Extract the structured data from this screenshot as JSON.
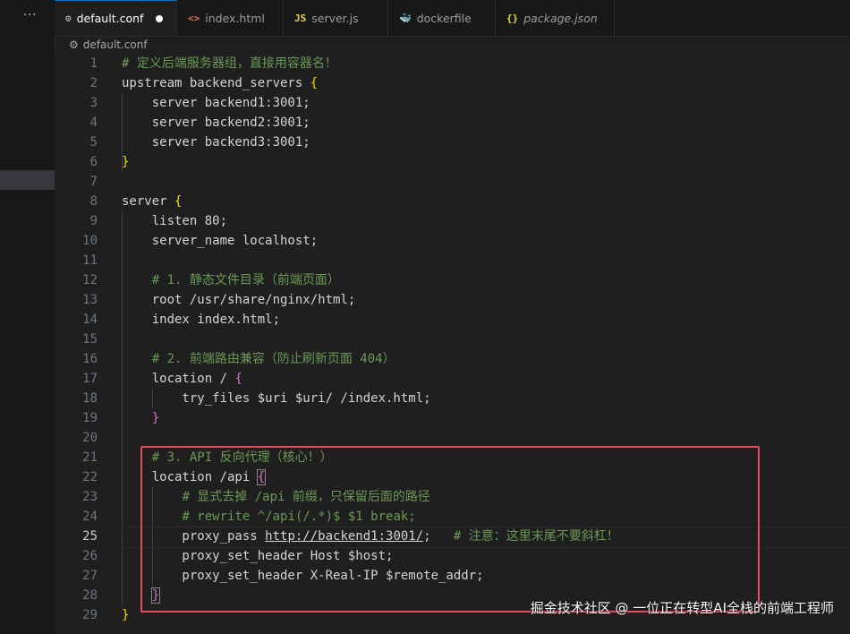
{
  "activity_bar": {
    "more_label": "···"
  },
  "tabs": [
    {
      "label": "default.conf",
      "icon": "⚙",
      "icon_color": "#c5c5c5",
      "modified": true,
      "active": true
    },
    {
      "label": "index.html",
      "icon": "<>",
      "icon_color": "#e8704b",
      "active": false
    },
    {
      "label": "server.js",
      "icon": "JS",
      "icon_color": "#e8d44d",
      "active": false
    },
    {
      "label": "dockerfile",
      "icon": "🐳",
      "icon_color": "#4a9fe0",
      "active": false
    },
    {
      "label": "package.json",
      "icon": "{}",
      "icon_color": "#e8d44d",
      "active": false,
      "italic": true
    }
  ],
  "breadcrumb": {
    "icon": "⚙",
    "label": "default.conf"
  },
  "editor": {
    "current_line": 25,
    "lines": [
      {
        "n": "1",
        "html": "<span class='c'># 定义后端服务器组，直接用容器名！</span>"
      },
      {
        "n": "2",
        "html": "upstream backend_servers <span class='b'>{</span>"
      },
      {
        "n": "3",
        "html": "    server backend1:3001;"
      },
      {
        "n": "4",
        "html": "    server backend2:3001;"
      },
      {
        "n": "5",
        "html": "    server backend3:3001;"
      },
      {
        "n": "6",
        "html": "<span class='b'>}</span>"
      },
      {
        "n": "7",
        "html": ""
      },
      {
        "n": "8",
        "html": "server <span class='b'>{</span>"
      },
      {
        "n": "9",
        "html": "    listen 80;"
      },
      {
        "n": "10",
        "html": "    server_name localhost;"
      },
      {
        "n": "11",
        "html": ""
      },
      {
        "n": "12",
        "html": "    <span class='c'># 1. 静态文件目录（前端页面）</span>"
      },
      {
        "n": "13",
        "html": "    root /usr/share/nginx/html;"
      },
      {
        "n": "14",
        "html": "    index index.html;"
      },
      {
        "n": "15",
        "html": ""
      },
      {
        "n": "16",
        "html": "    <span class='c'># 2. 前端路由兼容（防止刷新页面 404）</span>"
      },
      {
        "n": "17",
        "html": "    location / <span class='b2'>{</span>"
      },
      {
        "n": "18",
        "html": "        try_files $uri $uri/ /index.html;"
      },
      {
        "n": "19",
        "html": "    <span class='b2'>}</span>"
      },
      {
        "n": "20",
        "html": ""
      },
      {
        "n": "21",
        "html": "    <span class='c'># 3. API 反向代理（核心！）</span>"
      },
      {
        "n": "22",
        "html": "    location /api <span class='b2 hlbrace'>{</span>"
      },
      {
        "n": "23",
        "html": "        <span class='c'># 显式去掉 /api 前缀，只保留后面的路径</span>"
      },
      {
        "n": "24",
        "html": "        <span class='c'># rewrite ^/api(/.*)$ $1 break;</span>"
      },
      {
        "n": "25",
        "html": "        proxy_pass <span class='u'>http://backend1:3001/</span>;   <span class='c'># 注意：这里末尾不要斜杠！</span>"
      },
      {
        "n": "26",
        "html": "        proxy_set_header Host $host;"
      },
      {
        "n": "27",
        "html": "        proxy_set_header X-Real-IP $remote_addr;"
      },
      {
        "n": "28",
        "html": "    <span class='b2 hlbrace'>}</span>"
      },
      {
        "n": "29",
        "html": "<span class='b'>}</span>"
      }
    ]
  },
  "watermark": "掘金技术社区 @ 一位正在转型AI全栈的前端工程师",
  "colors": {
    "accent": "#0078d4",
    "highlight_box": "#e84a5f",
    "comment": "#6a9955"
  }
}
